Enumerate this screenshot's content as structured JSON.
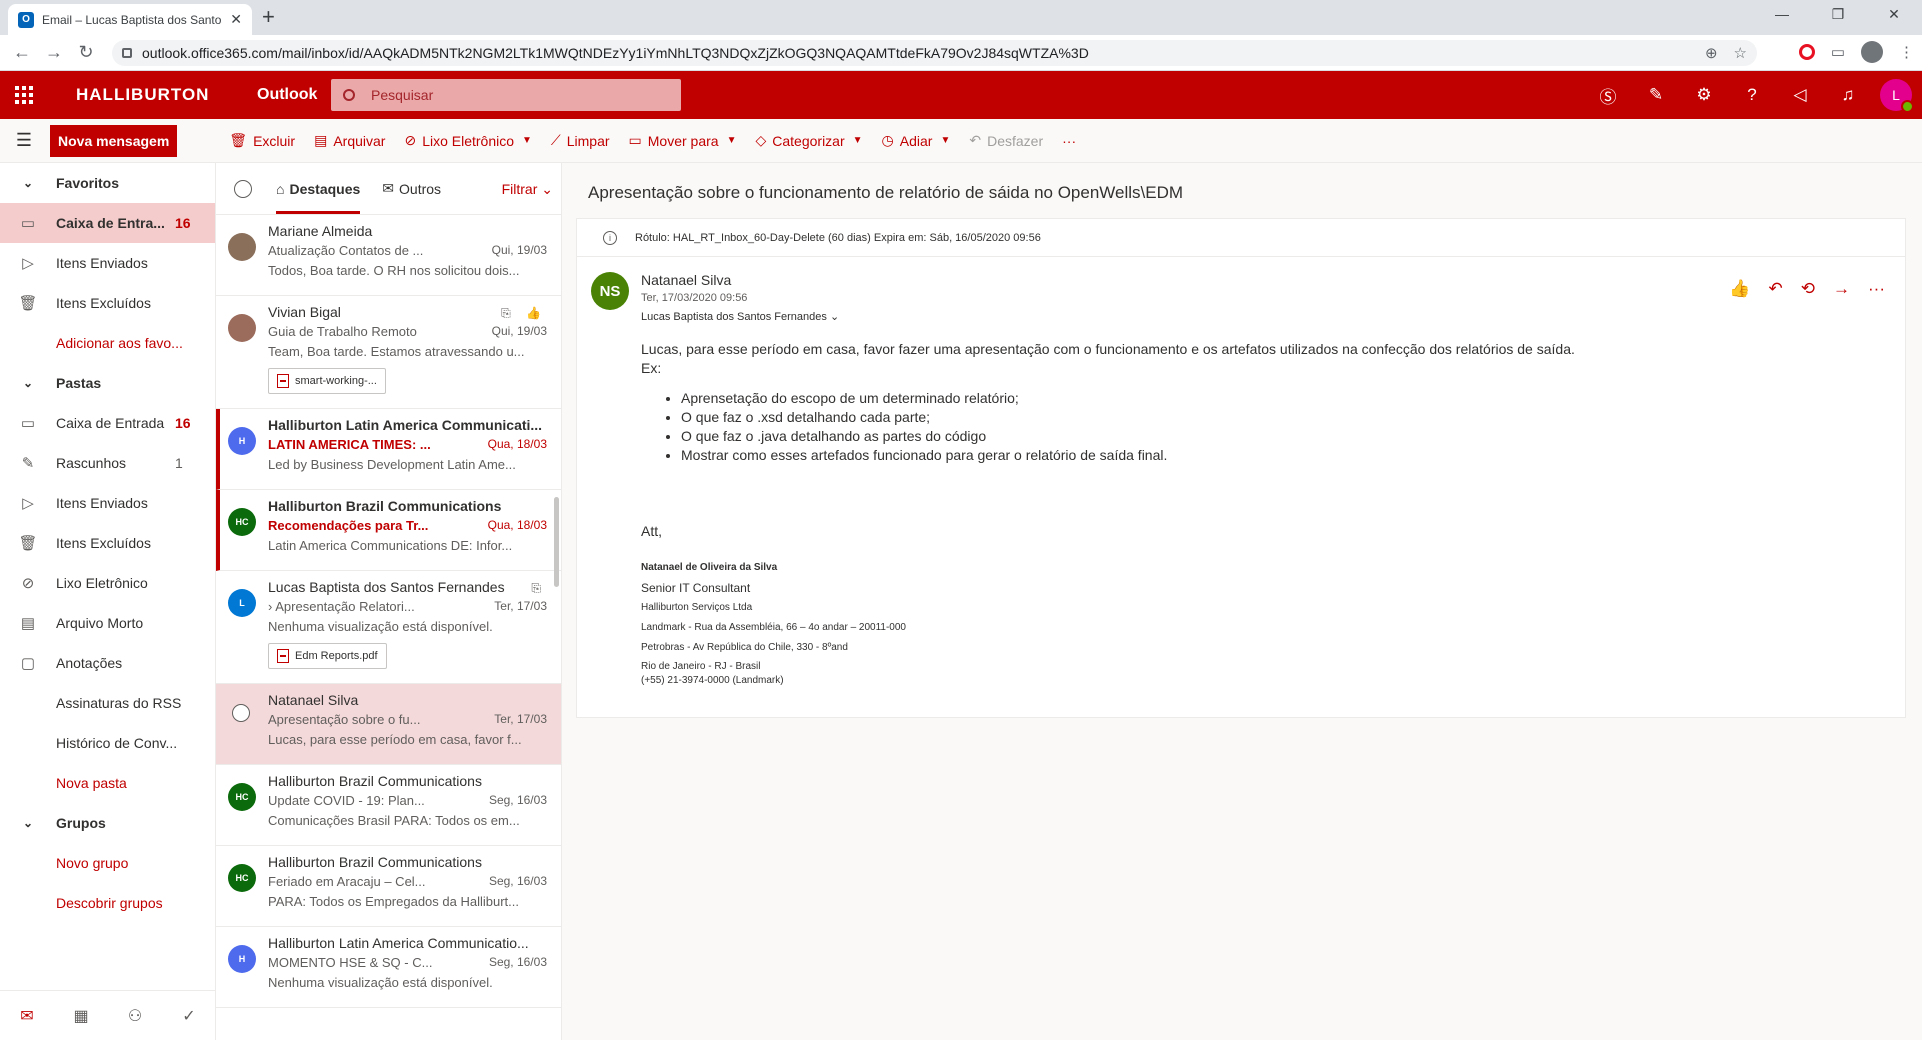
{
  "browser": {
    "tab_title": "Email – Lucas Baptista dos Santos",
    "url": "outlook.office365.com/mail/inbox/id/AAQkADM5NTk2NGM2LTk1MWQtNDEzYy1iYmNhLTQ3NDQxZjZkOGQ3NQAQAMTtdeFkA79Ov2J84sqWTZA%3D"
  },
  "header": {
    "brand": "HALLIBURTON",
    "app_name": "Outlook",
    "search_placeholder": "Pesquisar",
    "avatar_initial": "L"
  },
  "toolbar": {
    "new_message": "Nova mensagem",
    "delete": "Excluir",
    "archive": "Arquivar",
    "junk": "Lixo Eletrônico",
    "sweep": "Limpar",
    "move_to": "Mover para",
    "categorize": "Categorizar",
    "snooze": "Adiar",
    "undo": "Desfazer"
  },
  "leftnav": {
    "favorites_header": "Favoritos",
    "favorites": [
      {
        "label": "Caixa de Entra...",
        "count": "16"
      },
      {
        "label": "Itens Enviados"
      },
      {
        "label": "Itens Excluídos"
      },
      {
        "label": "Adicionar aos favo..."
      }
    ],
    "folders_header": "Pastas",
    "folders": [
      {
        "label": "Caixa de Entrada",
        "count": "16"
      },
      {
        "label": "Rascunhos",
        "count": "1"
      },
      {
        "label": "Itens Enviados"
      },
      {
        "label": "Itens Excluídos"
      },
      {
        "label": "Lixo Eletrônico"
      },
      {
        "label": "Arquivo Morto"
      },
      {
        "label": "Anotações"
      },
      {
        "label": "Assinaturas do RSS"
      },
      {
        "label": "Histórico de Conv..."
      },
      {
        "label": "Nova pasta"
      }
    ],
    "groups_header": "Grupos",
    "groups": [
      {
        "label": "Novo grupo"
      },
      {
        "label": "Descobrir grupos"
      }
    ]
  },
  "list": {
    "tab_focused": "Destaques",
    "tab_other": "Outros",
    "filter": "Filtrar",
    "messages": [
      {
        "sender": "Mariane Almeida",
        "subject": "Atualização Contatos de ...",
        "date": "Qui, 19/03",
        "preview": "Todos, Boa tarde. O RH nos solicitou dois..."
      },
      {
        "sender": "Vivian Bigal",
        "subject": "Guia de Trabalho Remoto",
        "date": "Qui, 19/03",
        "preview": "Team, Boa tarde. Estamos atravessando u...",
        "attachment": "smart-working-..."
      },
      {
        "sender": "Halliburton Latin America Communicati...",
        "subject": "LATIN AMERICA TIMES: ...",
        "date": "Qua, 18/03",
        "preview": "Led by Business Development Latin Ame...",
        "initials": "H"
      },
      {
        "sender": "Halliburton Brazil Communications",
        "subject": "Recomendações para Tr...",
        "date": "Qua, 18/03",
        "preview": "Latin America Communications DE: Infor...",
        "initials": "HC"
      },
      {
        "sender": "Lucas Baptista dos Santos Fernandes",
        "subject": "Apresentação Relatori...",
        "date": "Ter, 17/03",
        "preview": "Nenhuma visualização está disponível.",
        "initials": "L",
        "attachment": "Edm Reports.pdf"
      },
      {
        "sender": "Natanael Silva",
        "subject": "Apresentação sobre o fu...",
        "date": "Ter, 17/03",
        "preview": "Lucas, para esse período em casa, favor f..."
      },
      {
        "sender": "Halliburton Brazil Communications",
        "subject": "Update COVID - 19: Plan...",
        "date": "Seg, 16/03",
        "preview": "Comunicações Brasil PARA: Todos os em...",
        "initials": "HC"
      },
      {
        "sender": "Halliburton Brazil Communications",
        "subject": "Feriado em Aracaju – Cel...",
        "date": "Seg, 16/03",
        "preview": "PARA: Todos os Empregados da Halliburt...",
        "initials": "HC"
      },
      {
        "sender": "Halliburton Latin America Communicatio...",
        "subject": "MOMENTO HSE & SQ - C...",
        "date": "Seg, 16/03",
        "preview": "Nenhuma visualização está disponível.",
        "initials": "H"
      }
    ]
  },
  "reading": {
    "subject": "Apresentação sobre o funcionamento de relatório de sáida no OpenWells\\EDM",
    "label": "Rótulo: HAL_RT_Inbox_60-Day-Delete (60 dias) Expira em: Sáb, 16/05/2020 09:56",
    "from": "Natanael Silva",
    "initials": "NS",
    "date": "Ter, 17/03/2020 09:56",
    "to": "Lucas Baptista dos Santos Fernandes",
    "body_line1": "Lucas, para esse período em casa, favor fazer uma apresentação com o funcionamento e os artefatos utilizados na confecção dos relatórios de saída.",
    "body_line2": "Ex:",
    "bullets": [
      "Aprensetação do escopo de um determinado relatório;",
      "O que faz o .xsd detalhando cada parte;",
      "O que faz o .java detalhando as partes do código",
      "Mostrar como esses artefados funcionado para gerar o relatório de saída final."
    ],
    "closing": "Att,",
    "signature": {
      "name": "Natanael de Oliveira da Silva",
      "title": "Senior IT Consultant",
      "company": "Halliburton Serviços Ltda",
      "address1": "Landmark - Rua da Assembléia, 66 – 4o andar – 20011-000",
      "address2": "Petrobras - Av República do Chile, 330 - 8ºand",
      "city": "Rio de Janeiro - RJ - Brasil",
      "phone": "(+55) 21-3974-0000 (Landmark)"
    }
  },
  "colors": {
    "brand_red": "#c00000",
    "selected_bg": "#f4cccc",
    "avatar_blue": "#4f6bed",
    "avatar_green": "#0b6a0b",
    "avatar_ns": "#498205"
  }
}
